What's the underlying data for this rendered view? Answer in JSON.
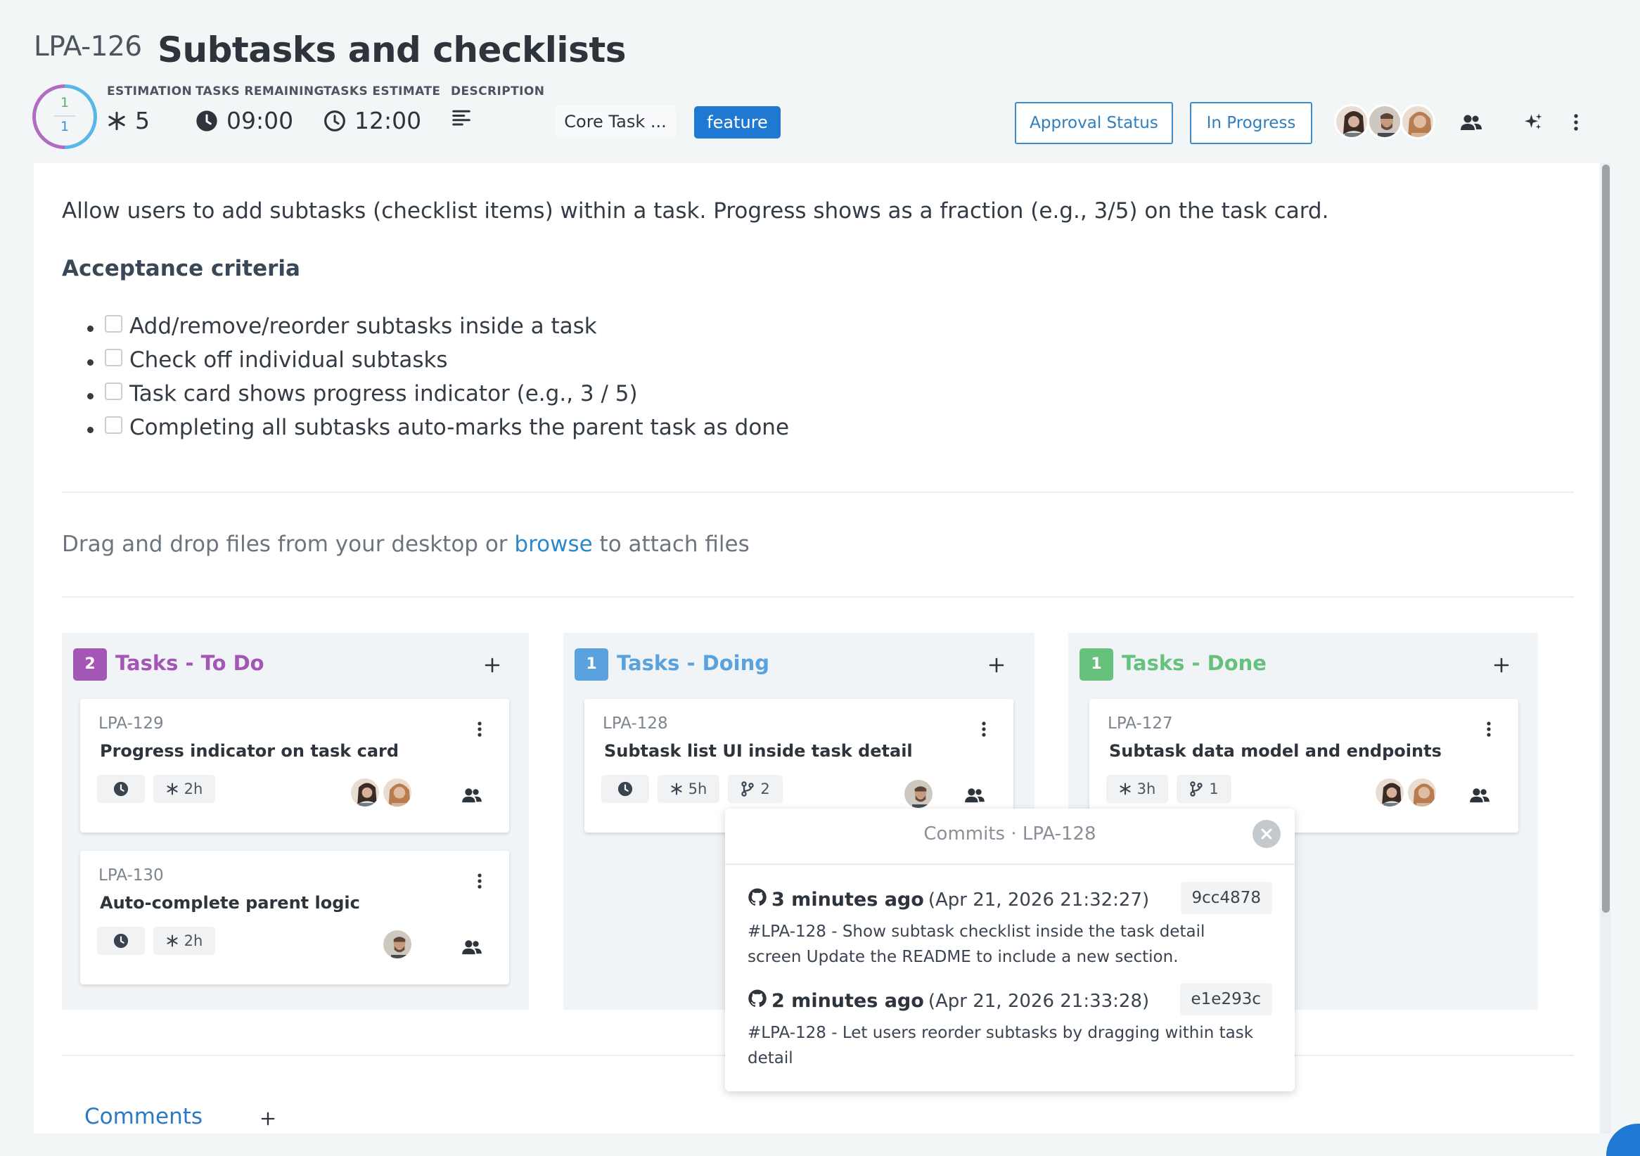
{
  "task": {
    "key": "LPA-126",
    "title": "Subtasks and checklists"
  },
  "progress_ring": {
    "top": "1",
    "bottom": "1"
  },
  "stats": {
    "estimation": {
      "label": "ESTIMATION",
      "value": "5"
    },
    "remaining": {
      "label": "TASKS REMAINING",
      "value": "09:00"
    },
    "estimate": {
      "label": "TASKS ESTIMATE",
      "value": "12:00"
    },
    "description": {
      "label": "DESCRIPTION"
    }
  },
  "tags": {
    "project": "Core Task ...",
    "type": "feature"
  },
  "buttons": {
    "approval": "Approval Status",
    "status": "In Progress"
  },
  "description_text": "Allow users to add subtasks (checklist items) within a task. Progress shows as a fraction (e.g., 3/5) on the task card.",
  "acceptance": {
    "title": "Acceptance criteria",
    "items": [
      {
        "label": "Add/remove/reorder subtasks inside a task",
        "checked": false
      },
      {
        "label": "Check off individual subtasks",
        "checked": false
      },
      {
        "label": "Task card shows progress indicator (e.g., 3 / 5)",
        "checked": false
      },
      {
        "label": "Completing all subtasks auto-marks the parent task as done",
        "checked": false
      }
    ]
  },
  "dropzone": {
    "before": "Drag and drop files from your desktop or ",
    "link": "browse",
    "after": " to attach files"
  },
  "columns": [
    {
      "count": "2",
      "title": "Tasks - To Do",
      "color": "#a356b5",
      "cards": [
        {
          "key": "LPA-129",
          "title": "Progress indicator on task card",
          "estimate": "2h"
        },
        {
          "key": "LPA-130",
          "title": "Auto-complete parent logic",
          "estimate": "2h"
        }
      ]
    },
    {
      "count": "1",
      "title": "Tasks - Doing",
      "color": "#5aa2dd",
      "cards": [
        {
          "key": "LPA-128",
          "title": "Subtask list UI inside task detail",
          "estimate": "5h",
          "commits": "2"
        }
      ]
    },
    {
      "count": "1",
      "title": "Tasks - Done",
      "color": "#66c17d",
      "cards": [
        {
          "key": "LPA-127",
          "title": "Subtask data model and endpoints",
          "estimate": "3h",
          "commits": "1"
        }
      ]
    }
  ],
  "commits_popover": {
    "title": "Commits · LPA-128",
    "commits": [
      {
        "ago": "3 minutes ago",
        "date": "(Apr 21, 2026 21:32:27)",
        "hash": "9cc4878",
        "message": "#LPA-128 - Show subtask checklist inside the task detail screen Update the README to include a new section."
      },
      {
        "ago": "2 minutes ago",
        "date": "(Apr 21, 2026 21:33:28)",
        "hash": "e1e293c",
        "message": "#LPA-128 - Let users reorder subtasks by dragging within task detail"
      }
    ]
  },
  "comments_label": "Comments",
  "icons": [
    "asterisk-icon",
    "clock-icon",
    "description-icon",
    "people-icon",
    "sparkle-icon",
    "kebab-icon",
    "branch-icon",
    "github-icon",
    "plus-icon",
    "close-icon"
  ]
}
